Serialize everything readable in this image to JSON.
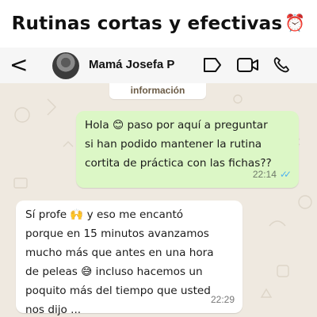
{
  "banner": {
    "title": "Rutinas cortas y efectivas",
    "emoji": "⏰",
    "emoji_icon": "alarm-clock-icon"
  },
  "header": {
    "back_glyph": "<",
    "contact_name": "Mamá Josefa P",
    "icons": [
      "back-icon",
      "avatar",
      "tag-icon",
      "video-call-icon",
      "phone-icon"
    ]
  },
  "chat": {
    "info_label": "información",
    "messages": [
      {
        "direction": "outgoing",
        "text": "Hola 😊 paso por aquí a preguntar\nsi han podido mantener la rutina\ncortita de práctica con las fichas??",
        "time": "22:14",
        "status": "read"
      },
      {
        "direction": "incoming",
        "text": "Sí profe 🙌 y eso me encantó\nporque en 15 minutos avanzamos\nmucho más que antes en una hora\nde peleas 😅 incluso hacemos un\npoquito más del tiempo que usted\nnos dijo ...",
        "time": "22:29"
      }
    ]
  },
  "colors": {
    "outgoing_bubble": "#dcf7c6",
    "incoming_bubble": "#ffffff",
    "chat_background": "#efe9e0",
    "read_ticks": "#4fb2f0"
  }
}
